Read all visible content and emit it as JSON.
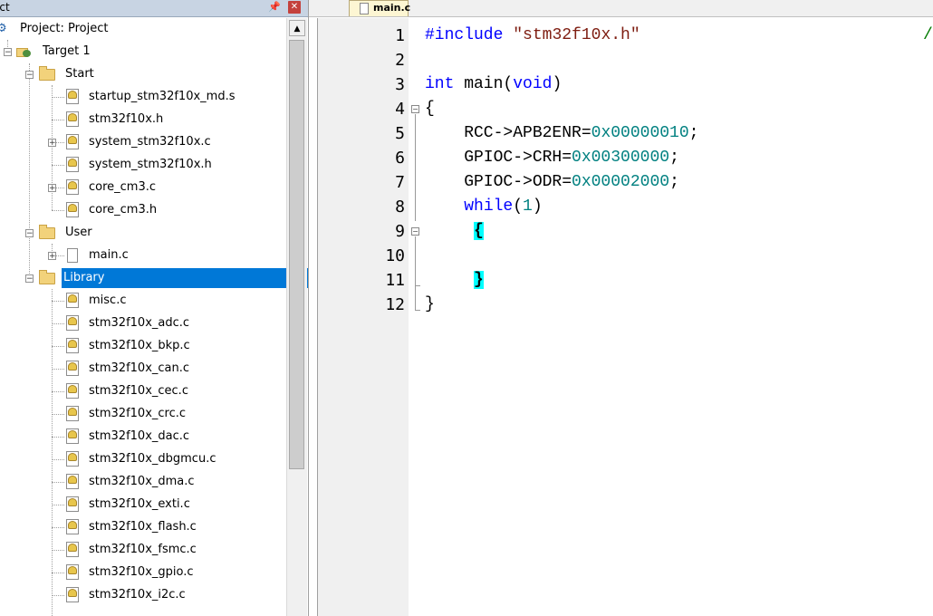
{
  "panel": {
    "title": "ect",
    "pin": "▕",
    "close": "✕"
  },
  "tree": {
    "project": "Project: Project",
    "target": "Target 1",
    "groups": {
      "start": "Start",
      "user": "User",
      "library": "Library"
    },
    "start_files": [
      "startup_stm32f10x_md.s",
      "stm32f10x.h",
      "system_stm32f10x.c",
      "system_stm32f10x.h",
      "core_cm3.c",
      "core_cm3.h"
    ],
    "user_files": [
      "main.c"
    ],
    "library_files": [
      "misc.c",
      "stm32f10x_adc.c",
      "stm32f10x_bkp.c",
      "stm32f10x_can.c",
      "stm32f10x_cec.c",
      "stm32f10x_crc.c",
      "stm32f10x_dac.c",
      "stm32f10x_dbgmcu.c",
      "stm32f10x_dma.c",
      "stm32f10x_exti.c",
      "stm32f10x_flash.c",
      "stm32f10x_fsmc.c",
      "stm32f10x_gpio.c",
      "stm32f10x_i2c.c"
    ]
  },
  "editor": {
    "tab_label": "main.c",
    "line_numbers": [
      "1",
      "2",
      "3",
      "4",
      "5",
      "6",
      "7",
      "8",
      "9",
      "10",
      "11",
      "12"
    ],
    "code": {
      "l1_directive": "#include",
      "l1_string": "\"stm32f10x.h\"",
      "l1_tail": "/",
      "l3_type": "int",
      "l3_name": " main(",
      "l3_param": "void",
      "l3_close": ")",
      "l4": "{",
      "l5_left": "    RCC->APB2ENR=",
      "l5_num": "0x00000010",
      "l5_end": ";",
      "l6_left": "    GPIOC->CRH=",
      "l6_num": "0x00300000",
      "l6_end": ";",
      "l7_left": "    GPIOC->ODR=",
      "l7_num": "0x00002000",
      "l7_end": ";",
      "l8_indent": "    ",
      "l8_kw": "while",
      "l8_open": "(",
      "l8_num": "1",
      "l8_close": ")",
      "l9_indent": "     ",
      "l9_brace": "{",
      "l11_indent": "     ",
      "l11_brace": "}",
      "l12": "}"
    }
  },
  "colors": {
    "selection": "#0078d7",
    "keyword": "#0000ff",
    "string": "#7e1d11",
    "number": "#008080",
    "brace_highlight": "#00ffff"
  }
}
